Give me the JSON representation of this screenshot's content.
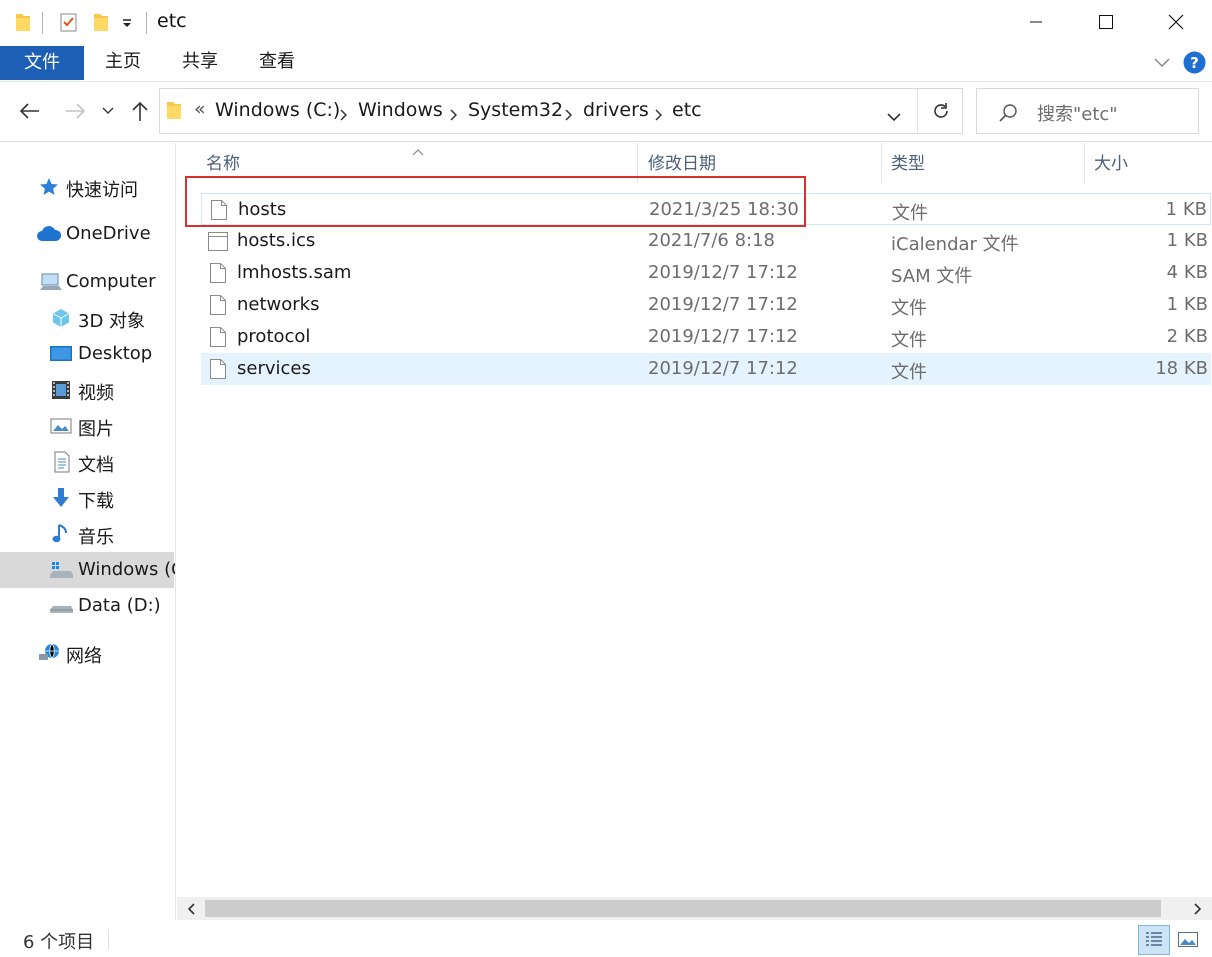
{
  "window": {
    "title": "etc",
    "controls": [
      "minimize",
      "maximize",
      "close"
    ]
  },
  "ribbon": {
    "tabs": [
      {
        "label": "文件",
        "active": true
      },
      {
        "label": "主页"
      },
      {
        "label": "共享"
      },
      {
        "label": "查看"
      }
    ]
  },
  "address": {
    "overflow": "«",
    "breadcrumbs": [
      "Windows (C:)",
      "Windows",
      "System32",
      "drivers",
      "etc"
    ]
  },
  "search": {
    "placeholder": "搜索\"etc\""
  },
  "sidebar": {
    "items": [
      {
        "label": "快速访问",
        "icon": "star-icon"
      },
      {
        "label": "OneDrive",
        "icon": "cloud-icon"
      },
      {
        "label": "Computer",
        "icon": "computer-icon"
      },
      {
        "label": "3D 对象",
        "icon": "cube-icon"
      },
      {
        "label": "Desktop",
        "icon": "desktop-icon"
      },
      {
        "label": "视频",
        "icon": "video-icon"
      },
      {
        "label": "图片",
        "icon": "picture-icon"
      },
      {
        "label": "文档",
        "icon": "document-icon"
      },
      {
        "label": "下载",
        "icon": "download-icon"
      },
      {
        "label": "音乐",
        "icon": "music-icon"
      },
      {
        "label": "Windows (C:)",
        "icon": "system-drive-icon",
        "selected": true
      },
      {
        "label": "Data (D:)",
        "icon": "drive-icon"
      },
      {
        "label": "网络",
        "icon": "network-icon"
      }
    ]
  },
  "filelist": {
    "columns": [
      "名称",
      "修改日期",
      "类型",
      "大小"
    ],
    "rows": [
      {
        "name": "hosts",
        "date": "2021/3/25 18:30",
        "type": "文件",
        "size": "1 KB",
        "icon": "file-icon"
      },
      {
        "name": "hosts.ics",
        "date": "2021/7/6 8:18",
        "type": "iCalendar 文件",
        "size": "1 KB",
        "icon": "calendar-file-icon"
      },
      {
        "name": "lmhosts.sam",
        "date": "2019/12/7 17:12",
        "type": "SAM 文件",
        "size": "4 KB",
        "icon": "file-icon"
      },
      {
        "name": "networks",
        "date": "2019/12/7 17:12",
        "type": "文件",
        "size": "1 KB",
        "icon": "file-icon"
      },
      {
        "name": "protocol",
        "date": "2019/12/7 17:12",
        "type": "文件",
        "size": "2 KB",
        "icon": "file-icon"
      },
      {
        "name": "services",
        "date": "2019/12/7 17:12",
        "type": "文件",
        "size": "18 KB",
        "icon": "file-icon",
        "highlighted": true
      }
    ]
  },
  "status": {
    "item_count": "6 个项目"
  },
  "colors": {
    "accent": "#1d5fb4",
    "annotation_box": "#d9302c",
    "row_highlight": "#e5f3ff"
  }
}
